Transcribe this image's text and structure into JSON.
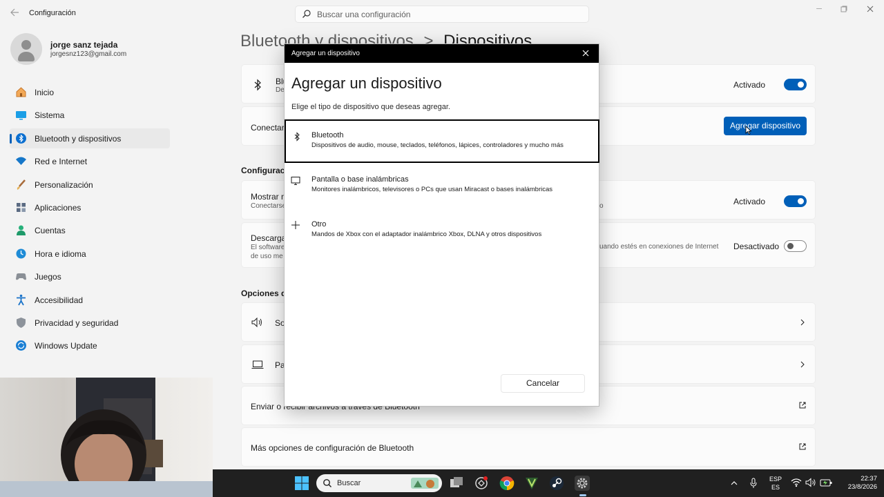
{
  "window": {
    "app_title": "Configuración",
    "search_placeholder": "Buscar una configuración"
  },
  "profile": {
    "name": "jorge sanz tejada",
    "email": "jorgesnz123@gmail.com"
  },
  "nav": {
    "items": [
      {
        "label": "Inicio",
        "icon": "home-icon"
      },
      {
        "label": "Sistema",
        "icon": "system-icon"
      },
      {
        "label": "Bluetooth y dispositivos",
        "icon": "bluetooth-icon",
        "active": true
      },
      {
        "label": "Red e Internet",
        "icon": "wifi-icon"
      },
      {
        "label": "Personalización",
        "icon": "brush-icon"
      },
      {
        "label": "Aplicaciones",
        "icon": "apps-icon"
      },
      {
        "label": "Cuentas",
        "icon": "accounts-icon"
      },
      {
        "label": "Hora e idioma",
        "icon": "globe-clock-icon"
      },
      {
        "label": "Juegos",
        "icon": "gamepad-icon"
      },
      {
        "label": "Accesibilidad",
        "icon": "accessibility-icon"
      },
      {
        "label": "Privacidad y seguridad",
        "icon": "shield-icon"
      },
      {
        "label": "Windows Update",
        "icon": "update-icon"
      }
    ]
  },
  "main": {
    "title_part1": "Bluetooth y dispositivos",
    "title_sep": ">",
    "title_part2": "Dispositivos",
    "bluetooth_card": {
      "title": "Blu",
      "sub": "De",
      "state": "Activado"
    },
    "connect_card": {
      "title": "Conectar",
      "button": "Agregar dispositivo"
    },
    "section_config": "Configuracio",
    "show_card": {
      "title": "Mostrar n",
      "sub": "Conectarse",
      "sub_right": "o",
      "state": "Activado"
    },
    "download_card": {
      "title": "Descarga",
      "sub1": "El software",
      "sub2": "de uso me",
      "sub_right": "uando estés en conexiones de Internet",
      "state": "Desactivado"
    },
    "section_options": "Opciones de",
    "sound_row": {
      "label": "So"
    },
    "screen_row": {
      "label": "Pa"
    },
    "send_row": {
      "label": "Enviar o recibir archivos a través de Bluetooth"
    },
    "more_row": {
      "label": "Más opciones de configuración de Bluetooth"
    }
  },
  "dialog": {
    "bar_title": "Agregar un dispositivo",
    "heading": "Agregar un dispositivo",
    "description": "Elige el tipo de dispositivo que deseas agregar.",
    "options": [
      {
        "title": "Bluetooth",
        "desc": "Dispositivos de audio, mouse, teclados, teléfonos, lápices, controladores y mucho más",
        "icon": "bluetooth-icon",
        "selected": true
      },
      {
        "title": "Pantalla o base inalámbricas",
        "desc": "Monitores inalámbricos, televisores o PCs que usan Miracast o bases inalámbricas",
        "icon": "monitor-icon"
      },
      {
        "title": "Otro",
        "desc": "Mandos de Xbox con el adaptador inalámbrico Xbox, DLNA y otros dispositivos",
        "icon": "plus-icon"
      }
    ],
    "cancel": "Cancelar"
  },
  "taskbar": {
    "search_label": "Buscar",
    "lang1": "ESP",
    "lang2": "ES",
    "time": "22:37",
    "date": "23/8/2026"
  },
  "colors": {
    "accent": "#005fb8",
    "background": "#f3f3f3",
    "card": "#fbfbfb",
    "taskbar": "#202020"
  }
}
